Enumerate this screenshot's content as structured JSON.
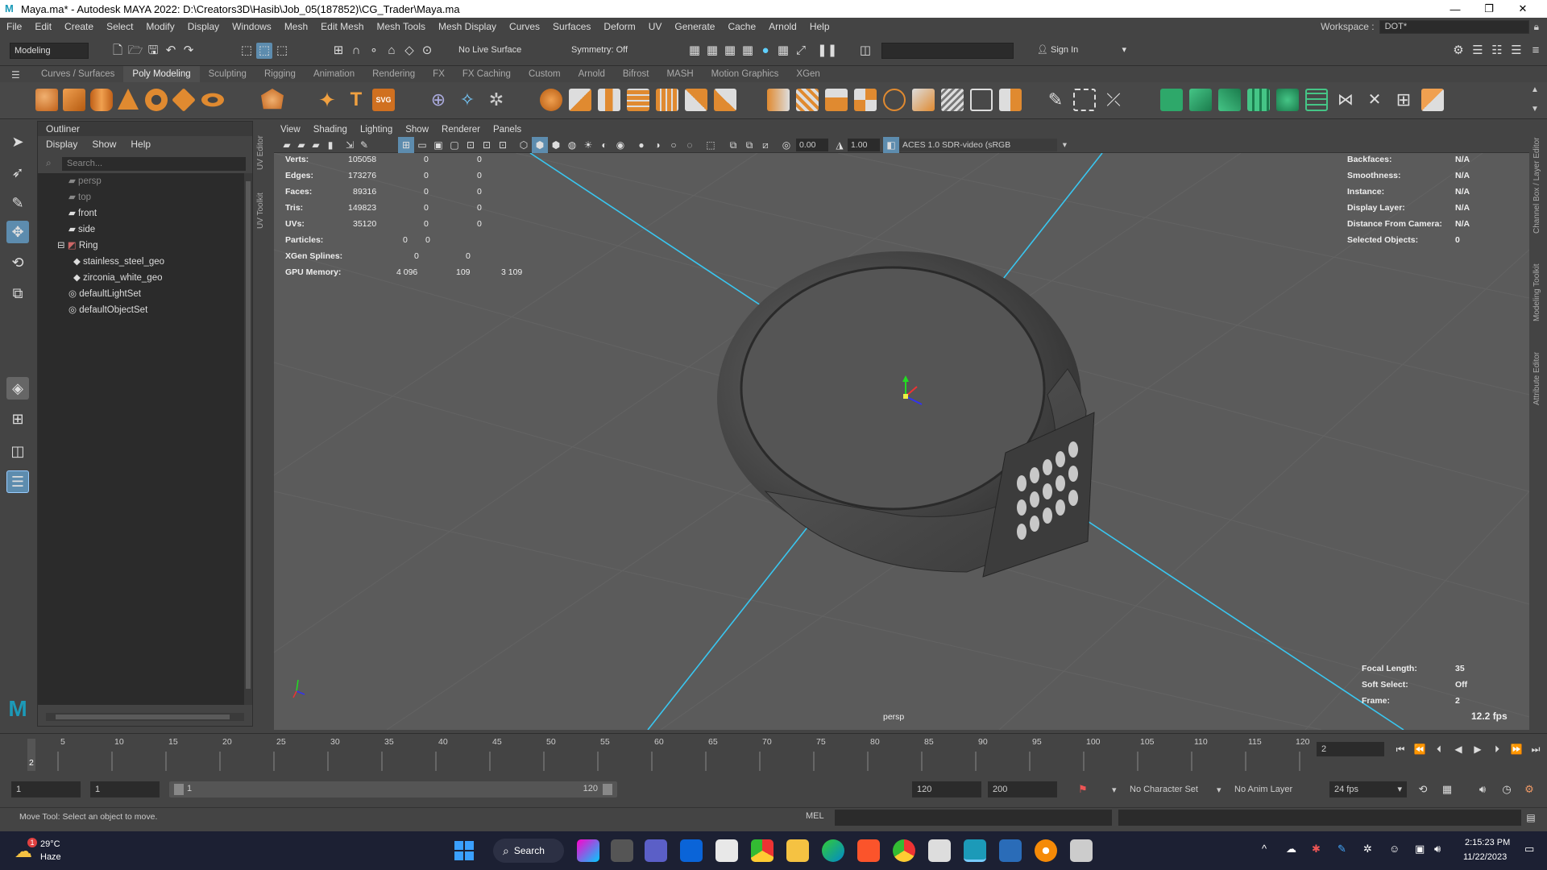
{
  "window": {
    "title": "Maya.ma* - Autodesk MAYA 2022: D:\\Creators3D\\Hasib\\Job_05(187852)\\CG_Trader\\Maya.ma",
    "minimize": "—",
    "maximize": "❐",
    "close": "✕"
  },
  "menubar": {
    "items": [
      "File",
      "Edit",
      "Create",
      "Select",
      "Modify",
      "Display",
      "Windows",
      "Mesh",
      "Edit Mesh",
      "Mesh Tools",
      "Mesh Display",
      "Curves",
      "Surfaces",
      "Deform",
      "UV",
      "Generate",
      "Cache",
      "Arnold",
      "Help"
    ],
    "workspace_label": "Workspace :",
    "workspace_value": "DOT*"
  },
  "statusline": {
    "mode": "Modeling",
    "live_surface": "No Live Surface",
    "symmetry": "Symmetry: Off",
    "sign_in": "Sign In"
  },
  "shelf": {
    "tabs": [
      "Curves / Surfaces",
      "Poly Modeling",
      "Sculpting",
      "Rigging",
      "Animation",
      "Rendering",
      "FX",
      "FX Caching",
      "Custom",
      "Arnold",
      "Bifrost",
      "MASH",
      "Motion Graphics",
      "XGen"
    ],
    "active_tab": "Poly Modeling",
    "svg_label": "SVG",
    "text_label": "T"
  },
  "outliner": {
    "title": "Outliner",
    "menu": [
      "Display",
      "Show",
      "Help"
    ],
    "search_placeholder": "Search...",
    "items": [
      {
        "label": "persp",
        "icon": "camera-icon",
        "indent": 0,
        "dim": true
      },
      {
        "label": "top",
        "icon": "camera-icon",
        "indent": 0,
        "dim": true
      },
      {
        "label": "front",
        "icon": "camera-icon",
        "indent": 0,
        "dim": false
      },
      {
        "label": "side",
        "icon": "camera-icon",
        "indent": 0,
        "dim": false
      },
      {
        "label": "Ring",
        "icon": "group-icon",
        "indent": 0,
        "dim": false,
        "expanded": true
      },
      {
        "label": "stainless_steel_geo",
        "icon": "mesh-icon",
        "indent": 1,
        "dim": false
      },
      {
        "label": "zirconia_white_geo",
        "icon": "mesh-icon",
        "indent": 1,
        "dim": false
      },
      {
        "label": "defaultLightSet",
        "icon": "set-icon",
        "indent": 0,
        "dim": false
      },
      {
        "label": "defaultObjectSet",
        "icon": "set-icon",
        "indent": 0,
        "dim": false
      }
    ]
  },
  "side_tabs": {
    "left": [
      "UV Editor",
      "UV Toolkit"
    ],
    "right": [
      "Channel Box / Layer Editor",
      "Modeling Toolkit",
      "Attribute Editor"
    ]
  },
  "viewport": {
    "menu": [
      "View",
      "Shading",
      "Lighting",
      "Show",
      "Renderer",
      "Panels"
    ],
    "exposure": "0.00",
    "gamma": "1.00",
    "color_space": "ACES 1.0 SDR-video (sRGB",
    "camera_name": "persp",
    "fps": "12.2 fps",
    "hud_left": [
      {
        "label": "Verts:",
        "v1": "105058",
        "v2": "0",
        "v3": "0"
      },
      {
        "label": "Edges:",
        "v1": "173276",
        "v2": "0",
        "v3": "0"
      },
      {
        "label": "Faces:",
        "v1": "89316",
        "v2": "0",
        "v3": "0"
      },
      {
        "label": "Tris:",
        "v1": "149823",
        "v2": "0",
        "v3": "0"
      },
      {
        "label": "UVs:",
        "v1": "35120",
        "v2": "0",
        "v3": "0"
      },
      {
        "label": "Particles:",
        "v1": "0",
        "v2": "0",
        "v3": ""
      },
      {
        "label": "XGen Splines:",
        "v1": "0",
        "v2": "0",
        "v3": ""
      },
      {
        "label": "GPU Memory:",
        "v1": "4 096",
        "v2": "109",
        "v3": "3 109"
      }
    ],
    "hud_right": [
      {
        "label": "Backfaces:",
        "value": "N/A"
      },
      {
        "label": "Smoothness:",
        "value": "N/A"
      },
      {
        "label": "Instance:",
        "value": "N/A"
      },
      {
        "label": "Display Layer:",
        "value": "N/A"
      },
      {
        "label": "Distance From Camera:",
        "value": "N/A"
      },
      {
        "label": "Selected Objects:",
        "value": "0"
      }
    ],
    "hud_bottom_right": [
      {
        "label": "Focal Length:",
        "value": "35"
      },
      {
        "label": "Soft Select:",
        "value": "Off"
      },
      {
        "label": "Frame:",
        "value": "2"
      }
    ]
  },
  "timeline": {
    "ticks": [
      "5",
      "10",
      "15",
      "20",
      "25",
      "30",
      "35",
      "40",
      "45",
      "50",
      "55",
      "60",
      "65",
      "70",
      "75",
      "80",
      "85",
      "90",
      "95",
      "100",
      "105",
      "110",
      "115",
      "120"
    ],
    "current_frame_marker": "2",
    "current_frame": "2"
  },
  "range": {
    "start": "1",
    "playback_start": "1",
    "slider_start": "1",
    "slider_end": "120",
    "playback_end": "120",
    "end": "200",
    "character_set": "No Character Set",
    "anim_layer": "No Anim Layer",
    "fps": "24 fps"
  },
  "commandline": {
    "help_text": "Move Tool: Select an object to move.",
    "language": "MEL"
  },
  "taskbar": {
    "weather_temp": "29°C",
    "weather_desc": "Haze",
    "weather_badge": "1",
    "search": "Search",
    "time": "2:15:23 PM",
    "date": "11/22/2023"
  }
}
